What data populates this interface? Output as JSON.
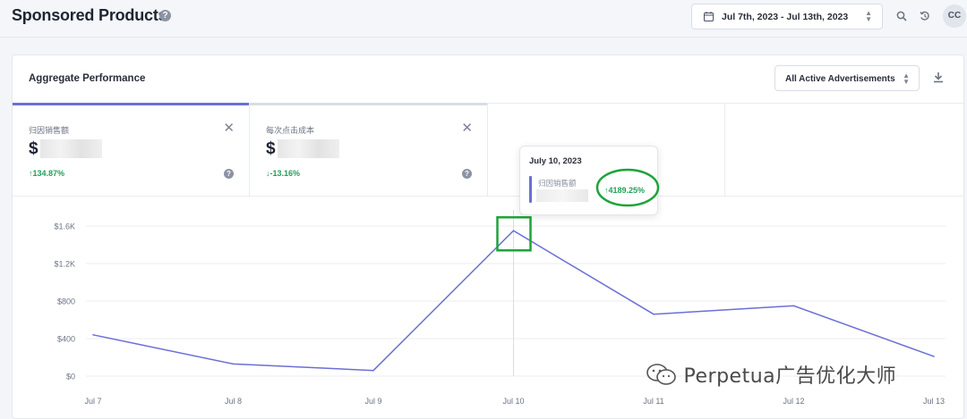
{
  "header": {
    "title": "Sponsored Products",
    "help_icon": "?",
    "date_range": "Jul 7th, 2023 - Jul 13th, 2023",
    "avatar_initials": "CC",
    "icons": [
      "calendar-icon",
      "search-icon",
      "history-icon"
    ]
  },
  "card": {
    "title": "Aggregate Performance",
    "filter_value": "All Active Advertisements",
    "download_icon": "download-icon"
  },
  "metrics": [
    {
      "label": "归因销售额",
      "value": "$",
      "change": "↑134.87%",
      "accent": "#6b6fd6"
    },
    {
      "label": "每次点击成本",
      "value": "$",
      "change": "↓-13.16%",
      "accent": "#d8dce3"
    }
  ],
  "tooltip": {
    "date": "July 10, 2023",
    "metric": "归因销售额",
    "change": "↑4189.25%"
  },
  "chart_data": {
    "type": "line",
    "categories": [
      "Jul 7",
      "Jul 8",
      "Jul 9",
      "Jul 10",
      "Jul 11",
      "Jul 12",
      "Jul 13"
    ],
    "series": [
      {
        "values": [
          440,
          130,
          60,
          1550,
          660,
          750,
          210
        ]
      }
    ],
    "y_ticks": [
      "$0",
      "$400",
      "$800",
      "$1.2K",
      "$1.6K"
    ],
    "ylim": [
      0,
      1600
    ],
    "grid": true,
    "color": "#6b6fd6",
    "highlight_category": "Jul 10"
  },
  "watermark": "Perpetua广告优化大师",
  "colors": {
    "accent": "#6b6fd6",
    "positive": "#21a05a",
    "annotation": "#1fa33a"
  }
}
